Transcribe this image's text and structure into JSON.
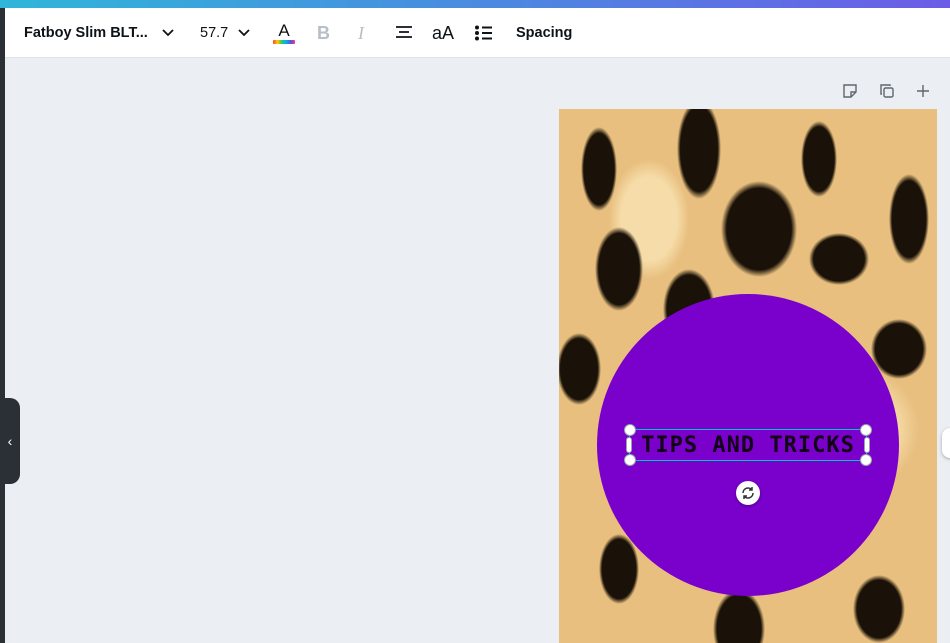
{
  "toolbar": {
    "font_name": "Fatboy Slim BLT...",
    "font_size": "57.7",
    "color_letter": "A",
    "bold_label": "B",
    "italic_label": "I",
    "case_label": "aA",
    "spacing_label": "Spacing"
  },
  "canvas": {
    "text_content": "TIPS AND TRICKS",
    "circle_color": "#7a00cc",
    "selection_color": "#00c4cc"
  },
  "page_actions": [
    "note-icon",
    "duplicate-page-icon",
    "add-page-icon"
  ],
  "sidebar": {
    "collapse_glyph": "‹"
  },
  "colors": {
    "accent_gradient": [
      "#2fb6d9",
      "#6c5ce7"
    ],
    "toolbar_bg": "#ffffff",
    "workspace_bg": "#ebeef2"
  }
}
